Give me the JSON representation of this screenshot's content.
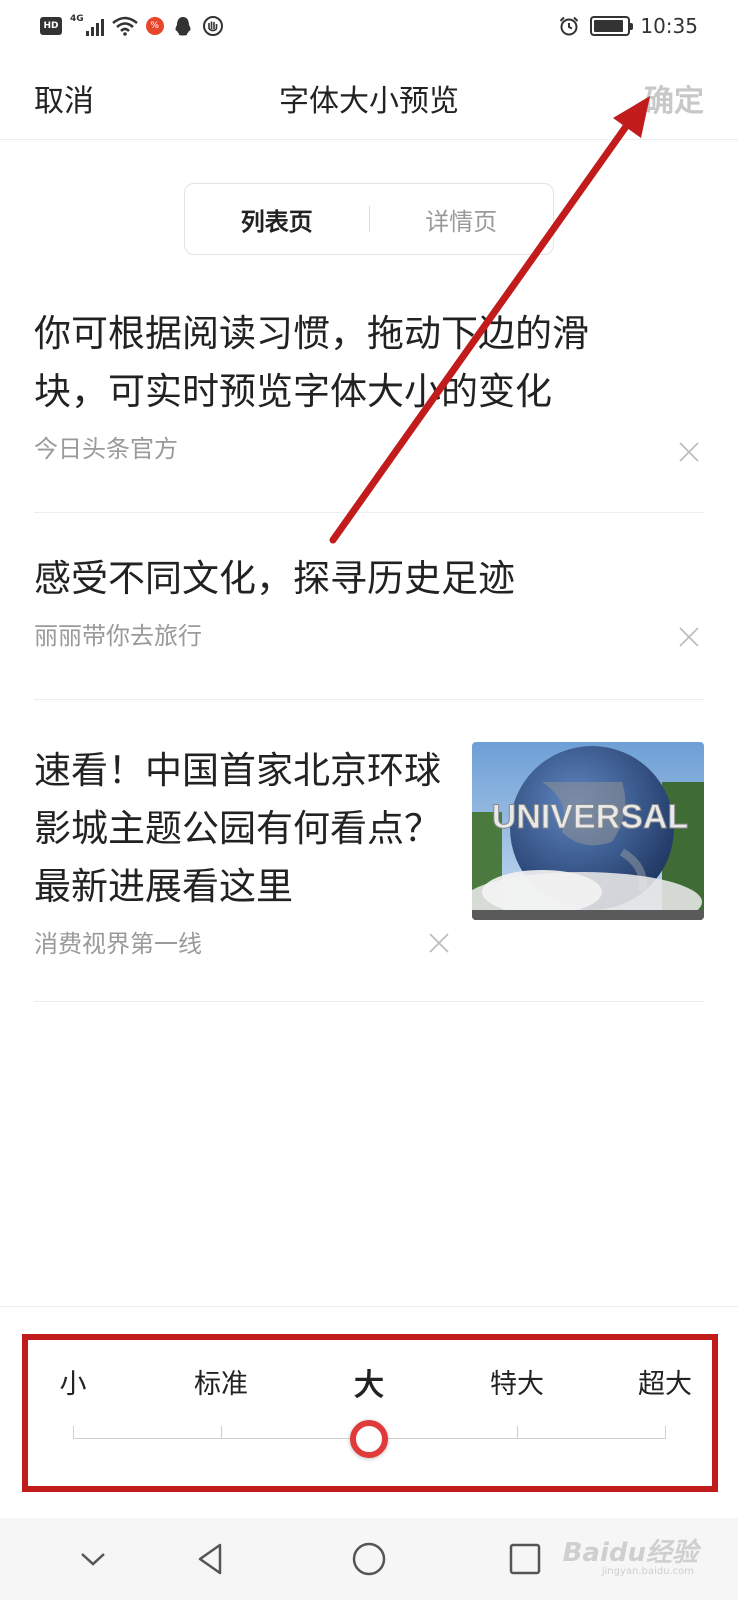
{
  "status_bar": {
    "hd": "HD",
    "network": "4G",
    "app_badge": "%",
    "time": "10:35",
    "battery_level": 0.9
  },
  "header": {
    "cancel": "取消",
    "title": "字体大小预览",
    "confirm": "确定"
  },
  "tabs": {
    "list": "列表页",
    "detail": "详情页",
    "active": "列表页"
  },
  "feed": [
    {
      "title": "你可根据阅读习惯，拖动下边的滑块，可实时预览字体大小的变化",
      "source": "今日头条官方"
    },
    {
      "title": "感受不同文化，探寻历史足迹",
      "source": "丽丽带你去旅行"
    },
    {
      "title": "速看！中国首家北京环球影城主题公园有何看点？最新进展看这里",
      "source": "消费视界第一线",
      "thumbnail_text": "UNIVERSAL"
    }
  ],
  "font_size": {
    "options": [
      "小",
      "标准",
      "大",
      "特大",
      "超大"
    ],
    "selected": "大",
    "selected_index": 2
  },
  "watermark": {
    "text": "Baidu经验",
    "sub": "jingyan.baidu.com"
  },
  "colors": {
    "accent": "#e03a3a",
    "annotation": "#c21b1b",
    "confirm_disabled": "#c8c8c8"
  }
}
